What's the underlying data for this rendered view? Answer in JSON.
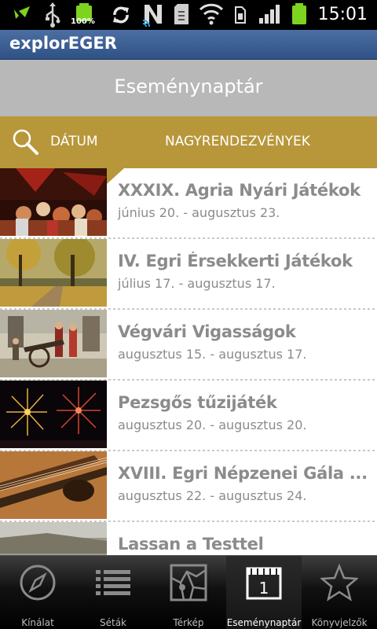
{
  "status_bar": {
    "battery_small_label": "100%",
    "time": "15:01",
    "icons": [
      "usb-debug-icon",
      "usb-icon",
      "battery-full-icon",
      "sync-icon",
      "n-icon",
      "sd-card-icon",
      "wifi-icon",
      "sim-icon",
      "signal-icon",
      "battery-icon"
    ]
  },
  "app": {
    "title": "explorEGER"
  },
  "page": {
    "title": "Eseménynaptár"
  },
  "filter": {
    "tab_date": "DÁTUM",
    "tab_big_events": "NAGYRENDEZVÉNYEK",
    "active_tab": "DÁTUM"
  },
  "events": [
    {
      "title": "XXXIX. Agria Nyári Játékok",
      "date": "június 20. - augusztus 23.",
      "image": "stage-performance"
    },
    {
      "title": "IV. Egri Érsekkerti Játékok",
      "date": "július 17. - augusztus 17.",
      "image": "autumn-park"
    },
    {
      "title": "Végvári Vigasságok",
      "date": "augusztus 15. - augusztus 17.",
      "image": "cannon-soldiers"
    },
    {
      "title": "Pezsgős tűzijáték",
      "date": "augusztus 20. - augusztus 20.",
      "image": "fireworks"
    },
    {
      "title": "XVIII. Egri Népzenei Gála ...",
      "date": "augusztus 22. - augusztus 24.",
      "image": "violin"
    },
    {
      "title": "Lassan a Testtel",
      "date": "",
      "image": "castle-wall"
    }
  ],
  "tabbar": {
    "tabs": [
      {
        "label": "Kínálat",
        "icon": "compass-icon"
      },
      {
        "label": "Séták",
        "icon": "list-icon"
      },
      {
        "label": "Térkép",
        "icon": "map-icon"
      },
      {
        "label": "Eseménynaptár",
        "icon": "calendar-icon"
      },
      {
        "label": "Könyvjelzők",
        "icon": "star-icon"
      }
    ],
    "active": "Eseménynaptár"
  },
  "colors": {
    "appbar": "#3a5c93",
    "header_gray": "#b8b8b8",
    "filter_gold": "#b7973a",
    "text_gray": "#8b8b8b",
    "battery_green": "#7ed321"
  }
}
